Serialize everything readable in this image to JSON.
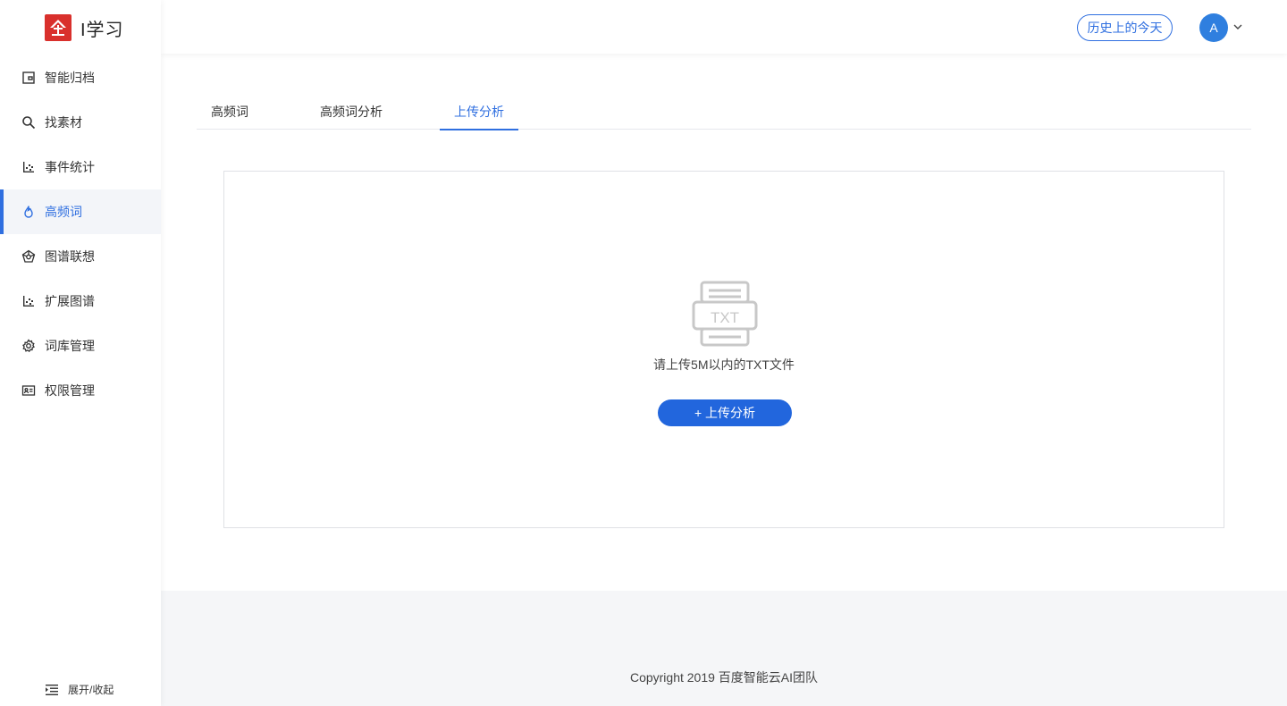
{
  "app": {
    "name": "I学习",
    "logo_color": "#d9302c"
  },
  "sidebar": {
    "items": [
      {
        "label": "智能归档",
        "icon": "archive-icon"
      },
      {
        "label": "找素材",
        "icon": "search-icon"
      },
      {
        "label": "事件统计",
        "icon": "scatter-chart-icon"
      },
      {
        "label": "高频词",
        "icon": "flame-icon",
        "active": true
      },
      {
        "label": "图谱联想",
        "icon": "graph-icon"
      },
      {
        "label": "扩展图谱",
        "icon": "scatter-chart-icon"
      },
      {
        "label": "词库管理",
        "icon": "gear-icon"
      },
      {
        "label": "权限管理",
        "icon": "id-card-icon"
      }
    ],
    "collapse_label": "展开/收起"
  },
  "header": {
    "history_button": "历史上的今天",
    "avatar_letter": "A"
  },
  "tabs": [
    {
      "label": "高频词"
    },
    {
      "label": "高频词分析"
    },
    {
      "label": "上传分析",
      "active": true
    }
  ],
  "upload": {
    "icon_text": "TXT",
    "hint": "请上传5M以内的TXT文件",
    "button_label": "+ 上传分析"
  },
  "footer": {
    "copyright": "Copyright 2019 百度智能云AI团队"
  },
  "colors": {
    "accent": "#2f6fe0",
    "button": "#2266dd"
  }
}
